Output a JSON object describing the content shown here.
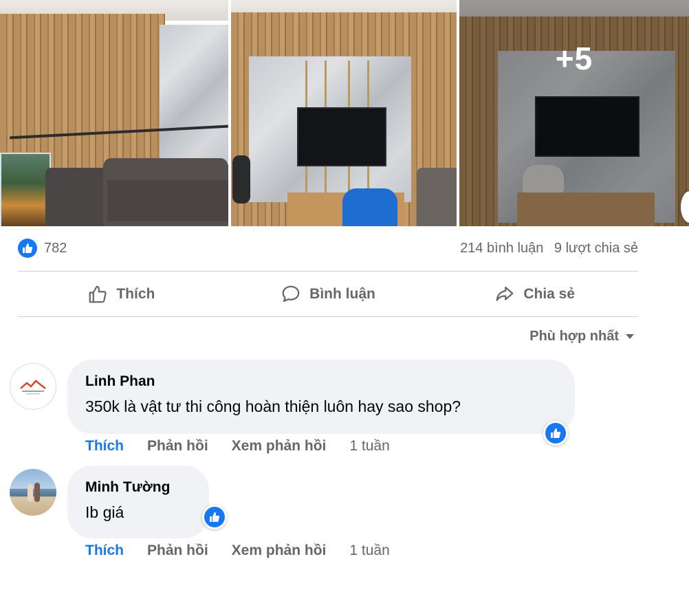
{
  "photos": {
    "more_count": "+5"
  },
  "stats": {
    "reaction_count": "782",
    "comments": "214 bình luận",
    "shares": "9 lượt chia sẻ"
  },
  "actions": {
    "like": "Thích",
    "comment": "Bình luận",
    "share": "Chia sẻ"
  },
  "sort": {
    "label": "Phù hợp nhất"
  },
  "comments": [
    {
      "author": "Linh Phan",
      "text": "350k là vật tư thi công hoàn thiện luôn hay sao shop?",
      "like": "Thích",
      "reply": "Phản hồi",
      "view_replies": "Xem phản hồi",
      "time": "1 tuần"
    },
    {
      "author": "Minh Tường",
      "text": "Ib giá",
      "like": "Thích",
      "reply": "Phản hồi",
      "view_replies": "Xem phản hồi",
      "time": "1 tuần"
    }
  ],
  "colors": {
    "accent": "#1877f2",
    "muted_text": "#65676b",
    "bubble": "#f0f2f5"
  }
}
